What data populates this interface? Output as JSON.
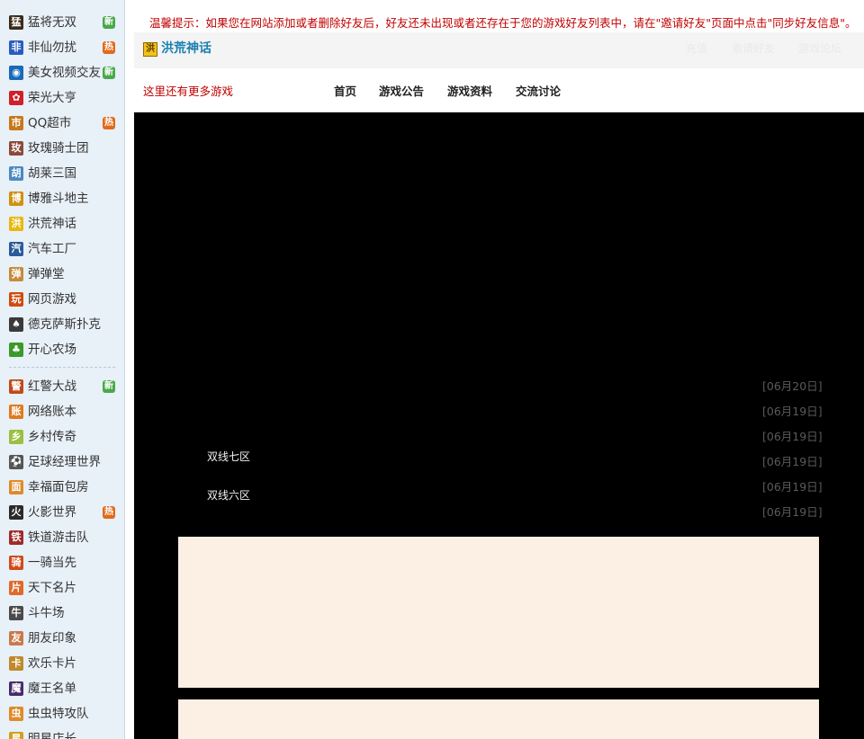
{
  "sidebar": {
    "items": [
      {
        "label": "猛将无双",
        "icon": "meng-icon",
        "icon_text": "猛",
        "icon_color": "#3a2a18",
        "badge": "新"
      },
      {
        "label": "非仙勿扰",
        "icon": "feixian-icon",
        "icon_text": "非",
        "icon_color": "#2a5cc0",
        "badge": "热"
      },
      {
        "label": "美女视频交友",
        "icon": "video-icon",
        "icon_text": "◉",
        "icon_color": "#1a6ab8",
        "badge": "新"
      },
      {
        "label": "荣光大亨",
        "icon": "rongguang-icon",
        "icon_text": "✿",
        "icon_color": "#d0202a",
        "badge": ""
      },
      {
        "label": "QQ超市",
        "icon": "supermarket-icon",
        "icon_text": "市",
        "icon_color": "#c8781a",
        "badge": "热"
      },
      {
        "label": "玫瑰骑士团",
        "icon": "rose-knight-icon",
        "icon_text": "玫",
        "icon_color": "#8a4a3a",
        "badge": ""
      },
      {
        "label": "胡莱三国",
        "icon": "hulai-icon",
        "icon_text": "胡",
        "icon_color": "#4a8ac0",
        "badge": ""
      },
      {
        "label": "博雅斗地主",
        "icon": "doudizhu-icon",
        "icon_text": "博",
        "icon_color": "#d09010",
        "badge": ""
      },
      {
        "label": "洪荒神话",
        "icon": "honghuang-icon",
        "icon_text": "洪",
        "icon_color": "#e8b810",
        "badge": ""
      },
      {
        "label": "汽车工厂",
        "icon": "car-factory-icon",
        "icon_text": "汽",
        "icon_color": "#2a5a9a",
        "badge": ""
      },
      {
        "label": "弹弹堂",
        "icon": "dandantang-icon",
        "icon_text": "弹",
        "icon_color": "#c88a3a",
        "badge": ""
      },
      {
        "label": "网页游戏",
        "icon": "web-game-icon",
        "icon_text": "玩",
        "icon_color": "#d04a10",
        "badge": ""
      },
      {
        "label": "德克萨斯扑克",
        "icon": "poker-icon",
        "icon_text": "♠",
        "icon_color": "#3a3a3a",
        "badge": ""
      },
      {
        "label": "开心农场",
        "icon": "farm-icon",
        "icon_text": "♣",
        "icon_color": "#3a9a2a",
        "badge": ""
      },
      {
        "label": "红警大战",
        "icon": "red-alert-icon",
        "icon_text": "警",
        "icon_color": "#c04a1a",
        "badge": "新"
      },
      {
        "label": "网络账本",
        "icon": "account-book-icon",
        "icon_text": "账",
        "icon_color": "#e07a1a",
        "badge": ""
      },
      {
        "label": "乡村传奇",
        "icon": "village-icon",
        "icon_text": "乡",
        "icon_color": "#9ac040",
        "badge": ""
      },
      {
        "label": "足球经理世界",
        "icon": "football-icon",
        "icon_text": "⚽",
        "icon_color": "#555555",
        "badge": ""
      },
      {
        "label": "幸福面包房",
        "icon": "bakery-icon",
        "icon_text": "面",
        "icon_color": "#e08a2a",
        "badge": ""
      },
      {
        "label": "火影世界",
        "icon": "naruto-icon",
        "icon_text": "火",
        "icon_color": "#2a2a2a",
        "badge": "热"
      },
      {
        "label": "铁道游击队",
        "icon": "railway-icon",
        "icon_text": "铁",
        "icon_color": "#a02a2a",
        "badge": ""
      },
      {
        "label": "一骑当先",
        "icon": "rider-icon",
        "icon_text": "骑",
        "icon_color": "#d04a1a",
        "badge": ""
      },
      {
        "label": "天下名片",
        "icon": "namecard-icon",
        "icon_text": "片",
        "icon_color": "#e06a2a",
        "badge": ""
      },
      {
        "label": "斗牛场",
        "icon": "bullfight-icon",
        "icon_text": "牛",
        "icon_color": "#4a4a4a",
        "badge": ""
      },
      {
        "label": "朋友印象",
        "icon": "impression-icon",
        "icon_text": "友",
        "icon_color": "#c87a4a",
        "badge": ""
      },
      {
        "label": "欢乐卡片",
        "icon": "card-icon",
        "icon_text": "卡",
        "icon_color": "#c08a2a",
        "badge": ""
      },
      {
        "label": "魔王名单",
        "icon": "devil-icon",
        "icon_text": "魔",
        "icon_color": "#4a2a6a",
        "badge": ""
      },
      {
        "label": "虫虫特攻队",
        "icon": "bug-icon",
        "icon_text": "虫",
        "icon_color": "#e08a2a",
        "badge": ""
      },
      {
        "label": "明星店长",
        "icon": "star-shop-icon",
        "icon_text": "星",
        "icon_color": "#d0a020",
        "badge": ""
      }
    ]
  },
  "notice": "温馨提示：如果您在网站添加或者删除好友后，好友还未出现或者还存在于您的游戏好友列表中，请在\"邀请好友\"页面中点击\"同步好友信息\"。",
  "header": {
    "game_title": "洪荒神话",
    "logo_text": "洪",
    "links": [
      "充值",
      "邀请好友",
      "游戏论坛"
    ]
  },
  "nav": {
    "more_games": "这里还有更多游戏",
    "items": [
      "首页",
      "游戏公告",
      "游戏资料",
      "交流讨论"
    ]
  },
  "content": {
    "news_dates": [
      "[06月20日]",
      "[06月19日]",
      "[06月19日]",
      "[06月19日]",
      "[06月19日]",
      "[06月19日]"
    ],
    "servers": [
      "双线七区",
      "双线六区"
    ]
  }
}
